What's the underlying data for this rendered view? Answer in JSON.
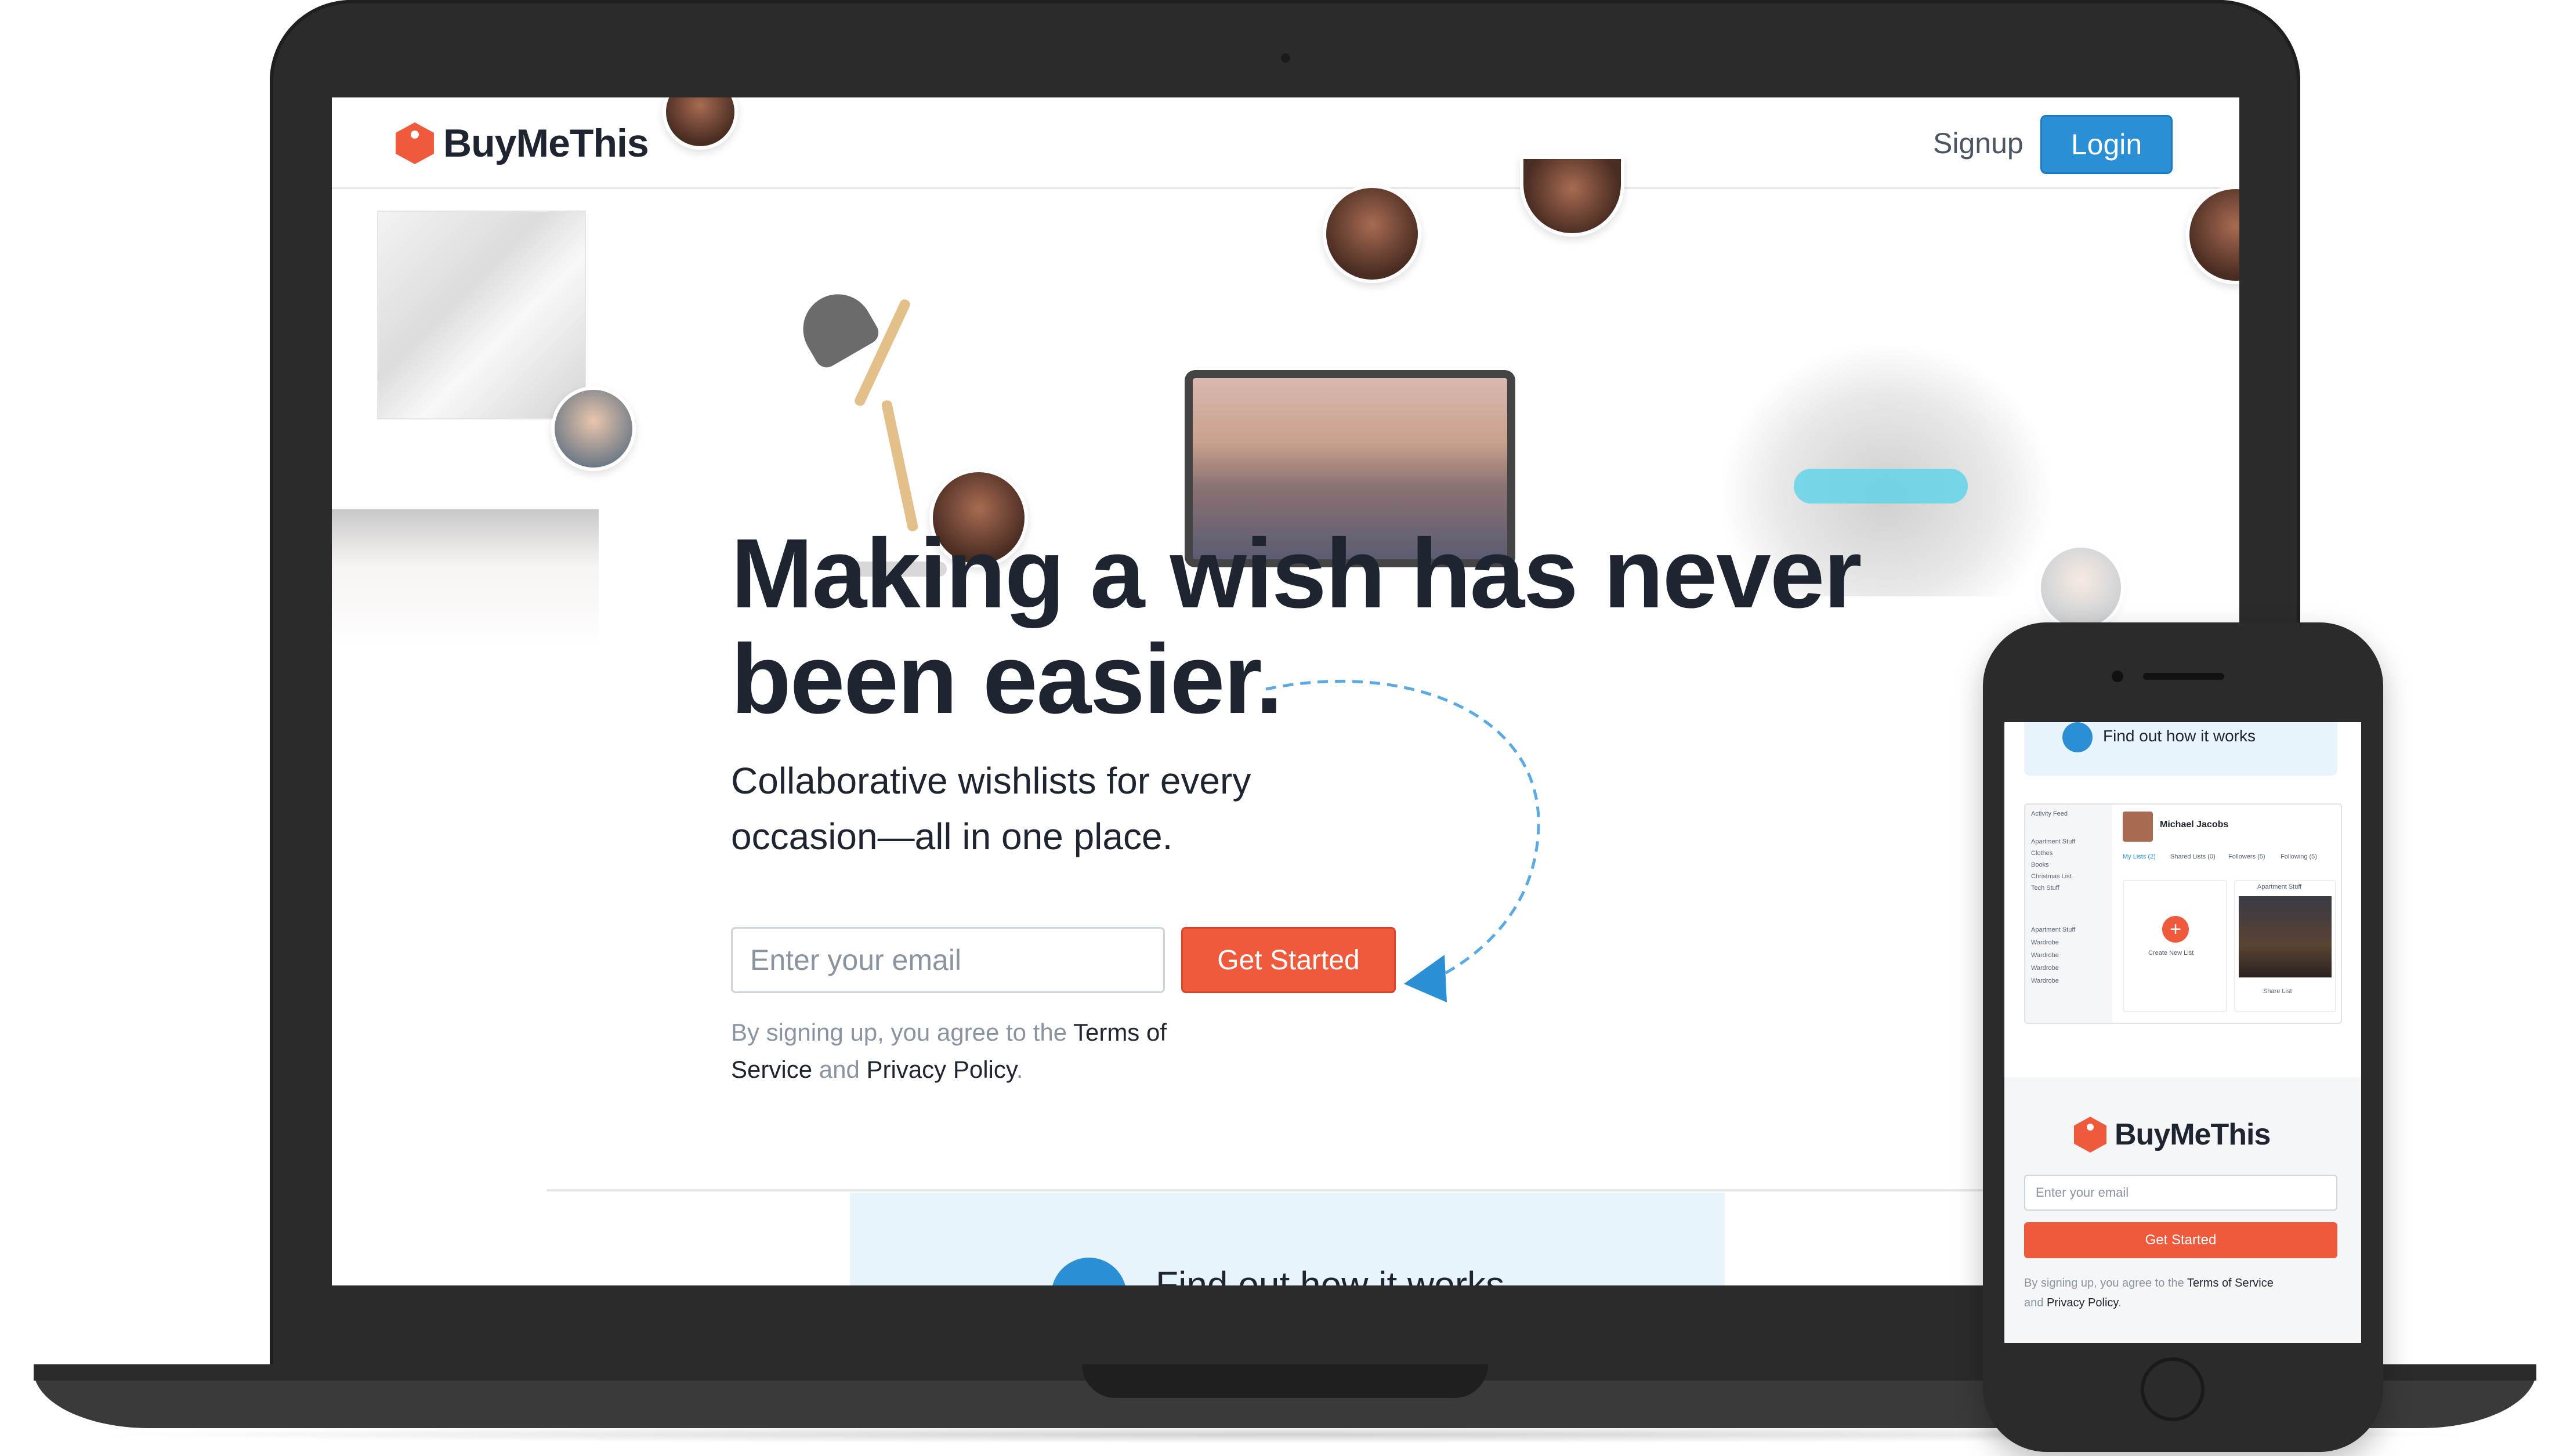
{
  "brand": {
    "name": "BuyMeThis",
    "accent_color": "#f05a3c",
    "primary_color": "#2b8fd6"
  },
  "nav": {
    "signup_label": "Signup",
    "login_label": "Login"
  },
  "hero": {
    "title": "Making a wish has never been easier.",
    "subtitle": "Collaborative wishlists for every occasion—all in one place.",
    "email_placeholder": "Enter your email",
    "cta_label": "Get Started",
    "terms": {
      "prefix": "By signing up, you agree to the ",
      "terms_link": "Terms of Service",
      "middle": " and ",
      "privacy_link": "Privacy Policy",
      "suffix": "."
    }
  },
  "video": {
    "label": "Find out how it works"
  },
  "phone": {
    "video_label": "Find out how it works",
    "app_preview": {
      "user_name": "Michael Jacobs",
      "sidebar_items": [
        "Activity Feed",
        "Apartment Stuff",
        "Clothes",
        "Books",
        "Christmas List",
        "Tech Stuff",
        "Apartment Stuff",
        "Wardrobe",
        "Wardrobe",
        "Wardrobe",
        "Wardrobe"
      ],
      "tabs": [
        "My Lists (2)",
        "Shared Lists (0)",
        "Followers (5)",
        "Following (5)"
      ],
      "new_list_label": "Create New List",
      "card_title": "Apartment Stuff",
      "share_label": "Share List"
    },
    "brand_name": "BuyMeThis",
    "email_placeholder": "Enter your email",
    "cta_label": "Get Started",
    "terms": {
      "prefix": "By signing up, you agree to the ",
      "terms_link": "Terms of Service",
      "middle": " and ",
      "privacy_link": "Privacy Policy",
      "suffix": "."
    }
  }
}
